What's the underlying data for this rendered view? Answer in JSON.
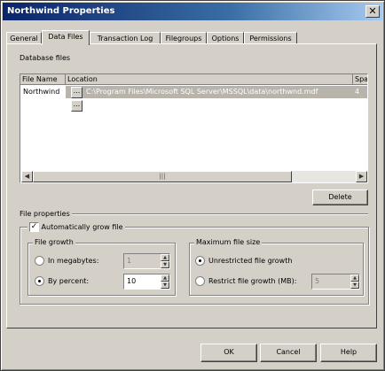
{
  "window": {
    "title": "Northwind Properties",
    "close_label": "✕"
  },
  "tabs": [
    {
      "label": "General"
    },
    {
      "label": "Data Files"
    },
    {
      "label": "Transaction Log"
    },
    {
      "label": "Filegroups"
    },
    {
      "label": "Options"
    },
    {
      "label": "Permissions"
    }
  ],
  "database_files": {
    "section_label": "Database files",
    "columns": [
      "File Name",
      "Location",
      "Spa"
    ],
    "rows": [
      {
        "file_name": "Northwind",
        "location": "C:\\Program Files\\Microsoft SQL Server\\MSSQL\\data\\northwnd.mdf",
        "space": "4",
        "button_label": "..."
      },
      {
        "file_name": "",
        "location": "",
        "space": "",
        "button_label": "..."
      }
    ],
    "delete_label": "Delete"
  },
  "file_properties": {
    "section_label": "File properties",
    "auto_grow_label": "Automatically grow file",
    "auto_grow_checked": true,
    "file_growth": {
      "legend": "File growth",
      "megabytes_label": "In megabytes:",
      "megabytes_value": "1",
      "percent_label": "By percent:",
      "percent_value": "10",
      "selected": "percent"
    },
    "max_size": {
      "legend": "Maximum file size",
      "unrestricted_label": "Unrestricted file growth",
      "restrict_label": "Restrict file growth (MB):",
      "restrict_value": "5",
      "selected": "unrestricted"
    }
  },
  "footer": {
    "ok_label": "OK",
    "cancel_label": "Cancel",
    "help_label": "Help"
  },
  "icons": {
    "close": "close-icon",
    "scroll_left": "scroll-left-icon",
    "scroll_right": "scroll-right-icon",
    "spin_up": "spin-up-icon",
    "spin_down": "spin-down-icon"
  }
}
